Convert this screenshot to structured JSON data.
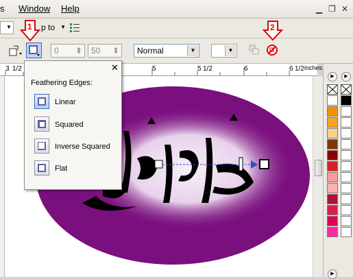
{
  "menubar": {
    "partial_item": "s",
    "items": [
      {
        "label": "Window"
      },
      {
        "label": "Help"
      }
    ]
  },
  "toolbar": {
    "snap_label": "p to",
    "outline_x": "0",
    "outline_y": "50",
    "merge_mode": "Normal"
  },
  "ruler": {
    "labels": [
      "3",
      "1/2",
      "5",
      "5",
      "1/2",
      "6",
      "6",
      "1/2",
      "inches"
    ]
  },
  "flyout": {
    "title": "Feathering Edges:",
    "options": [
      {
        "label": "Linear",
        "selected": true
      },
      {
        "label": "Squared",
        "selected": false
      },
      {
        "label": "Inverse Squared",
        "selected": false
      },
      {
        "label": "Flat",
        "selected": false
      }
    ]
  },
  "annotations": [
    {
      "number": "1",
      "color": "#e00000"
    },
    {
      "number": "2",
      "color": "#e00000"
    }
  ],
  "artwork": {
    "ellipse_color": "#7a0f7e",
    "glow_color": "#f3e9f4",
    "calligraphy_color": "#000000"
  },
  "palette": {
    "colors": [
      "#ffffff",
      "#000000",
      "#ff8c00",
      "#ffffff",
      "#f5a623",
      "#ffffff",
      "#ffd08a",
      "#ffffff",
      "#7a3a00",
      "#ffffff",
      "#8b0000",
      "#ffffff",
      "#d82020",
      "#ffffff",
      "#ff9a9a",
      "#ffffff",
      "#ffb0b0",
      "#ffffff",
      "#b0103a",
      "#ffffff",
      "#d8204a",
      "#ffffff",
      "#e0005a",
      "#ffffff",
      "#ff2aa0",
      "#ffffff"
    ]
  }
}
